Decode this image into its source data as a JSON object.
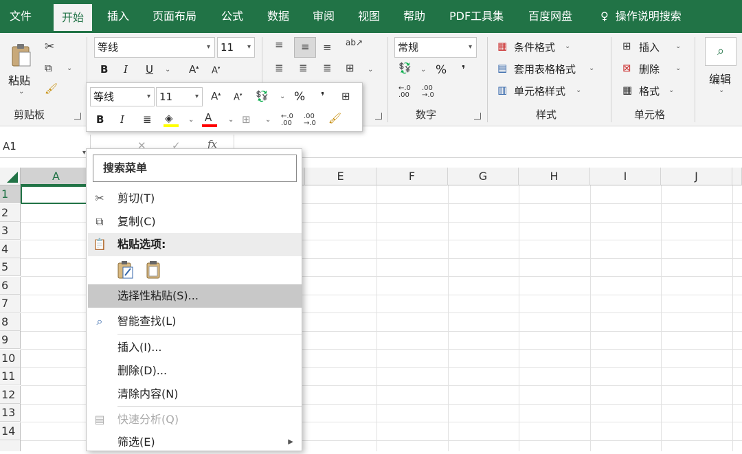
{
  "tabs": [
    "文件",
    "开始",
    "插入",
    "页面布局",
    "公式",
    "数据",
    "审阅",
    "视图",
    "帮助",
    "PDF工具集",
    "百度网盘"
  ],
  "tell_me": "操作说明搜索",
  "clipboard": {
    "paste": "粘贴",
    "group": "剪贴板"
  },
  "font": {
    "name": "等线",
    "size": "11",
    "bold": "B",
    "italic": "I",
    "underline": "U"
  },
  "number": {
    "format": "常规",
    "percent": "%",
    "comma": "❜",
    "group": "数字"
  },
  "styles": {
    "cond": "条件格式",
    "table": "套用表格格式",
    "cell": "单元格样式",
    "group": "样式"
  },
  "cells": {
    "insert": "插入",
    "delete": "删除",
    "format": "格式",
    "group": "单元格"
  },
  "editing": {
    "label": "编辑"
  },
  "namebox": "A1",
  "fx": "fx",
  "columns": [
    "A",
    "E",
    "F",
    "G",
    "H",
    "I",
    "J"
  ],
  "rows": [
    "1",
    "2",
    "3",
    "4",
    "5",
    "6",
    "7",
    "8",
    "9",
    "10",
    "11",
    "12",
    "13",
    "14"
  ],
  "mini": {
    "font": "等线",
    "size": "11",
    "bold": "B",
    "italic": "I",
    "percent": "%",
    "comma": "❜"
  },
  "menu": {
    "search": "搜索菜单",
    "items": [
      "剪切(T)",
      "复制(C)",
      "粘贴选项:",
      "选择性粘贴(S)...",
      "智能查找(L)",
      "插入(I)...",
      "删除(D)...",
      "清除内容(N)",
      "快速分析(Q)",
      "筛选(E)"
    ]
  }
}
